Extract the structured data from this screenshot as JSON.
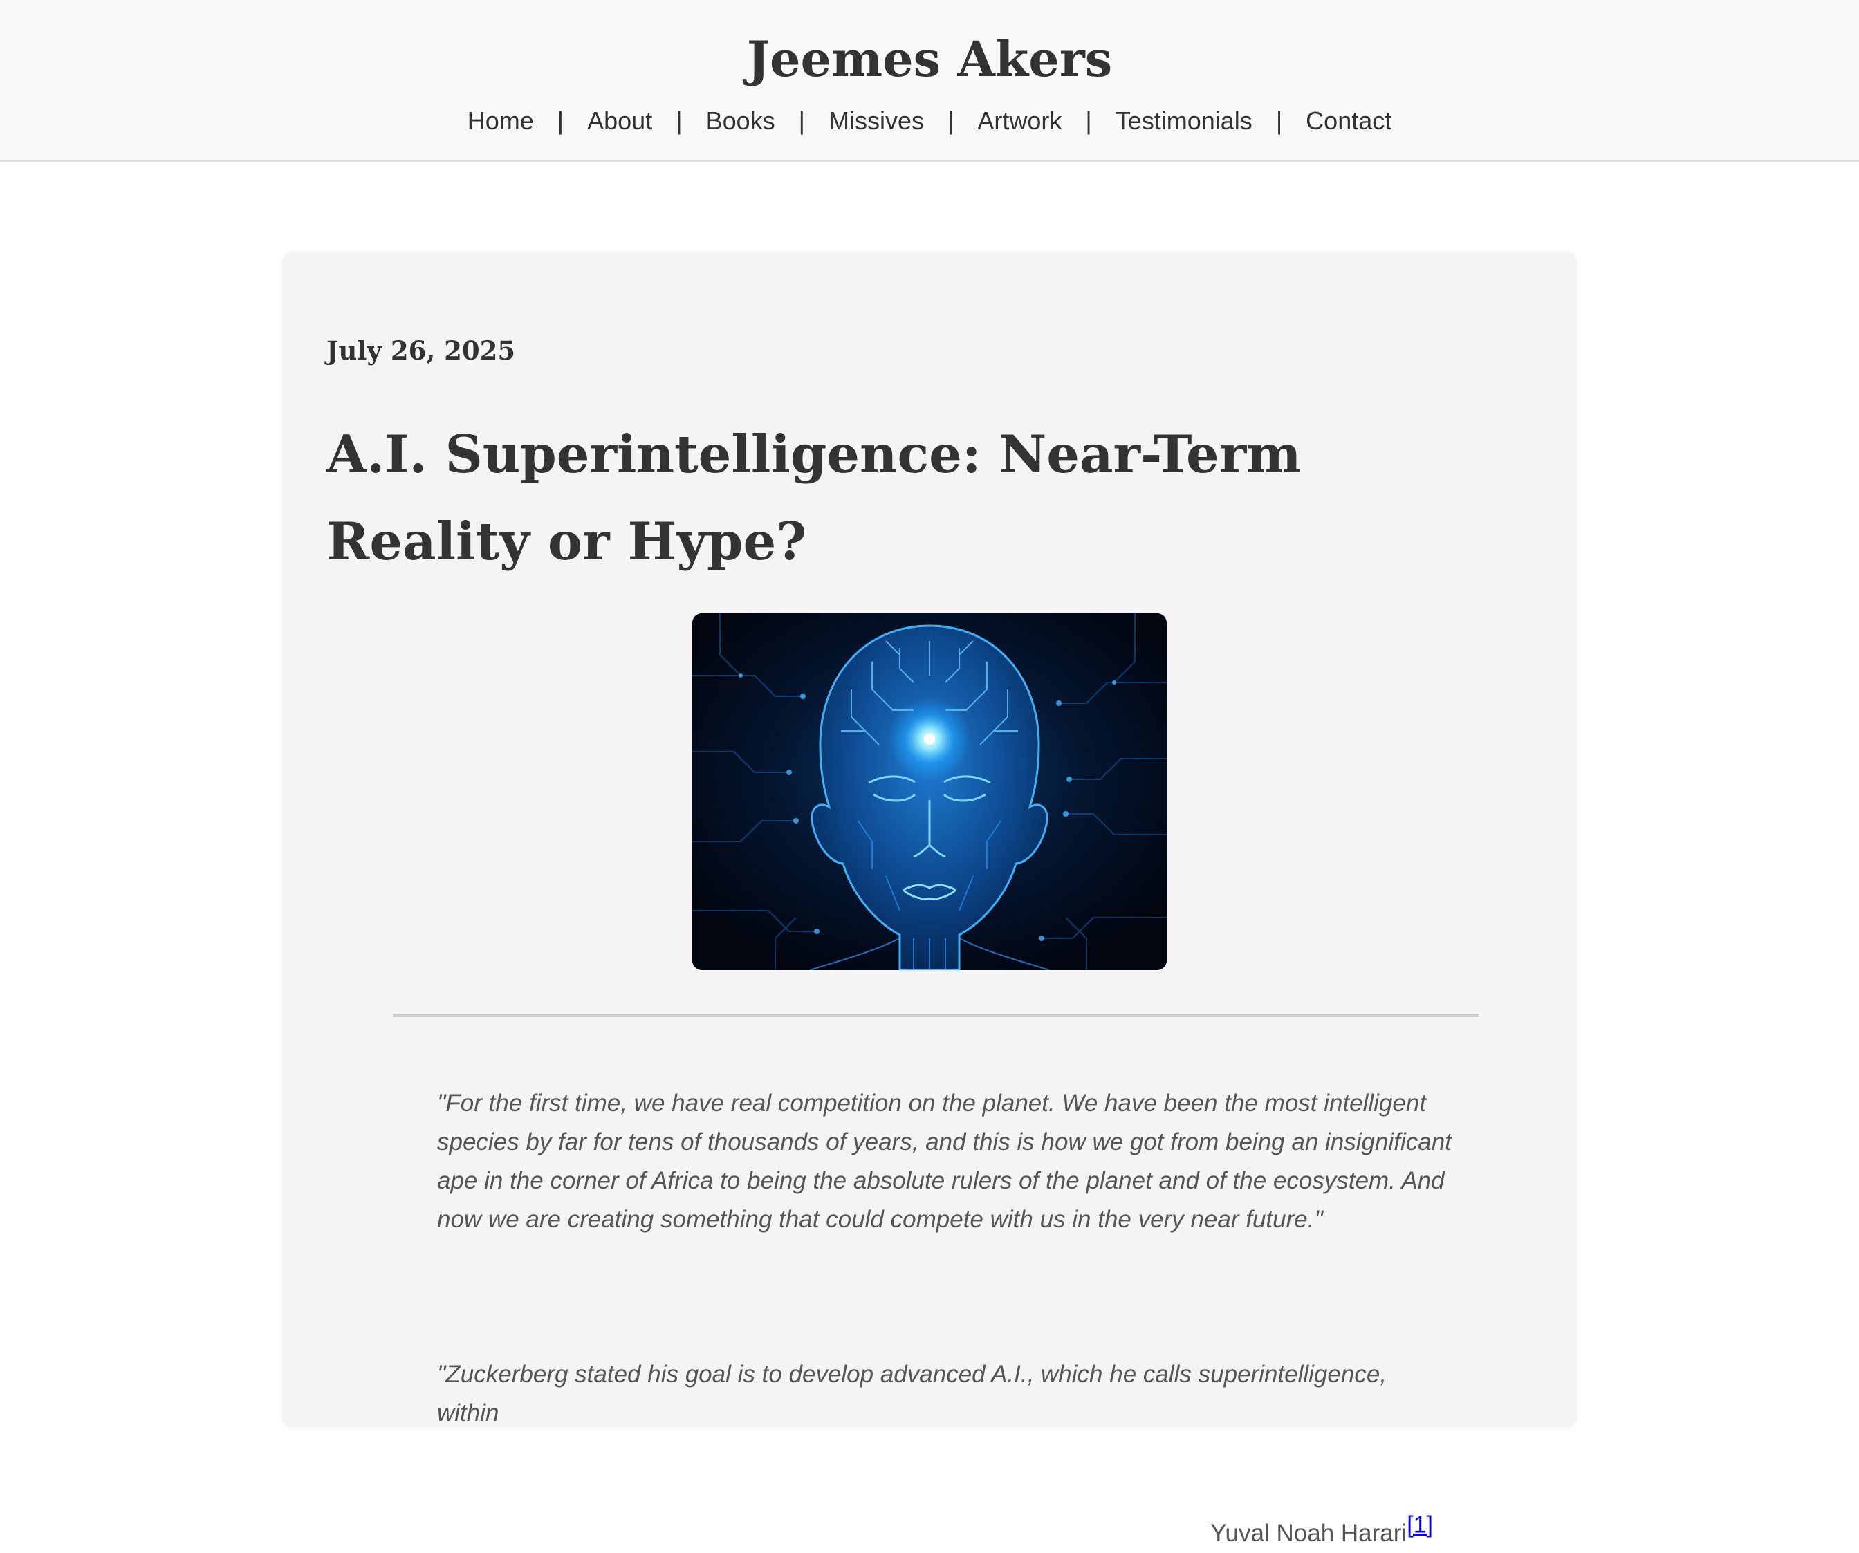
{
  "site": {
    "title": "Jeemes Akers"
  },
  "nav": {
    "separator": "|",
    "items": [
      {
        "label": "Home"
      },
      {
        "label": "About"
      },
      {
        "label": "Books"
      },
      {
        "label": "Missives"
      },
      {
        "label": "Artwork"
      },
      {
        "label": "Testimonials"
      },
      {
        "label": "Contact"
      }
    ]
  },
  "post": {
    "date": "July 26, 2025",
    "title": "A.I. Superintelligence: Near-Term Reality or Hype?",
    "image_icon": "glowing-circuit-head",
    "quote1": "\"For the first time, we have real competition on the planet. We have been the most intelligent species by far for tens of thousands of years, and this is how we got from being an insignificant ape in the corner of Africa to being the absolute rulers of the planet and of the ecosystem. And now we are creating something that could compete with us in the very near future.\"",
    "quote1_author": "Yuval Noah Harari",
    "quote1_footnote": "[1]",
    "quote2": "\"Zuckerberg stated his goal is to develop advanced A.I., which he calls superintelligence, within"
  },
  "colors": {
    "header_bg": "#f8f8f8",
    "card_bg": "#f4f4f4",
    "text": "#333333",
    "quote_text": "#555555",
    "link": "#0000ee",
    "hero_glow": "#2aa8ff"
  }
}
